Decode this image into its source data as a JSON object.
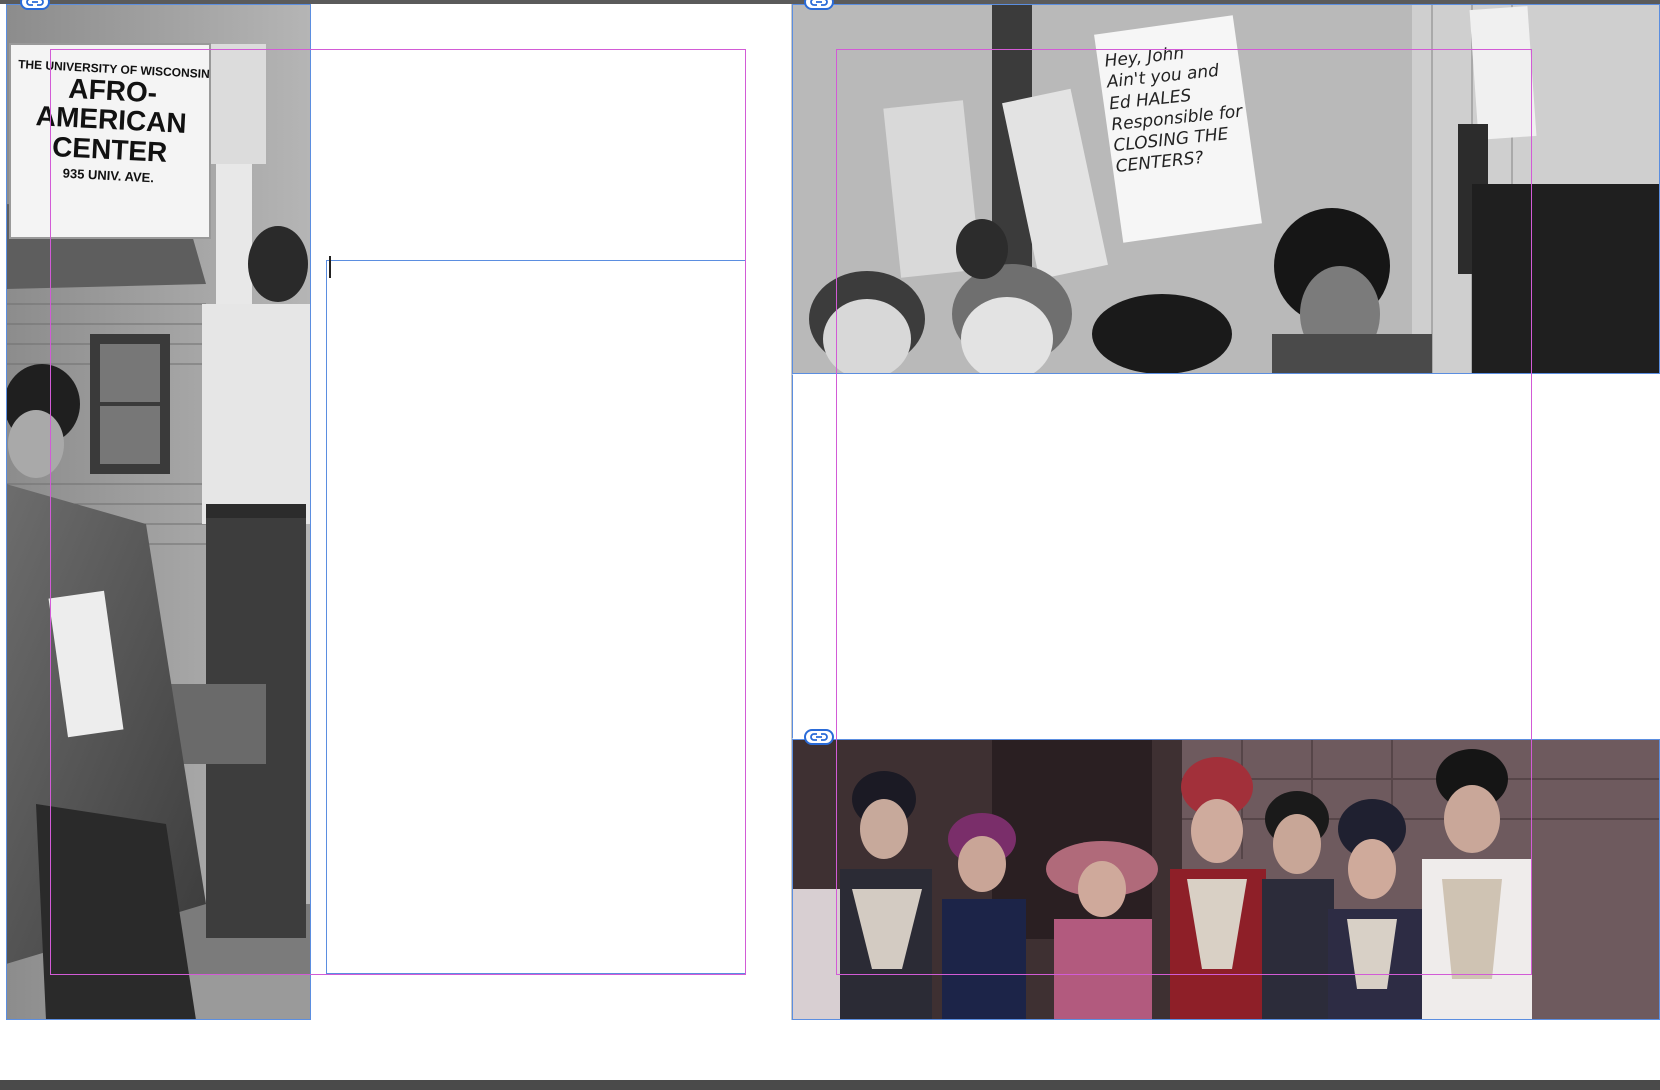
{
  "document": {
    "left_page": {
      "photo_afro_center": {
        "sign_lines": [
          "THE UNIVERSITY OF WISCONSIN",
          "AFRO-",
          "AMERICAN",
          "CENTER",
          "935 UNIV. AVE."
        ]
      },
      "text_frame": {
        "content": ""
      }
    },
    "right_page": {
      "photo_protest": {
        "placard_text": "Hey, John\nAin't you and\nEd HALES\nResponsible for\nCLOSING THE\nCENTERS?"
      },
      "empty_frame": {
        "content": ""
      },
      "photo_group": {}
    }
  },
  "colors": {
    "pasteboard": "#5b5b5b",
    "frame_edge": "#5b8ee0",
    "margin_guide": "#d25bd6",
    "link_badge": "#2a6bd8"
  },
  "icons": {
    "link": "chain-link-icon"
  }
}
